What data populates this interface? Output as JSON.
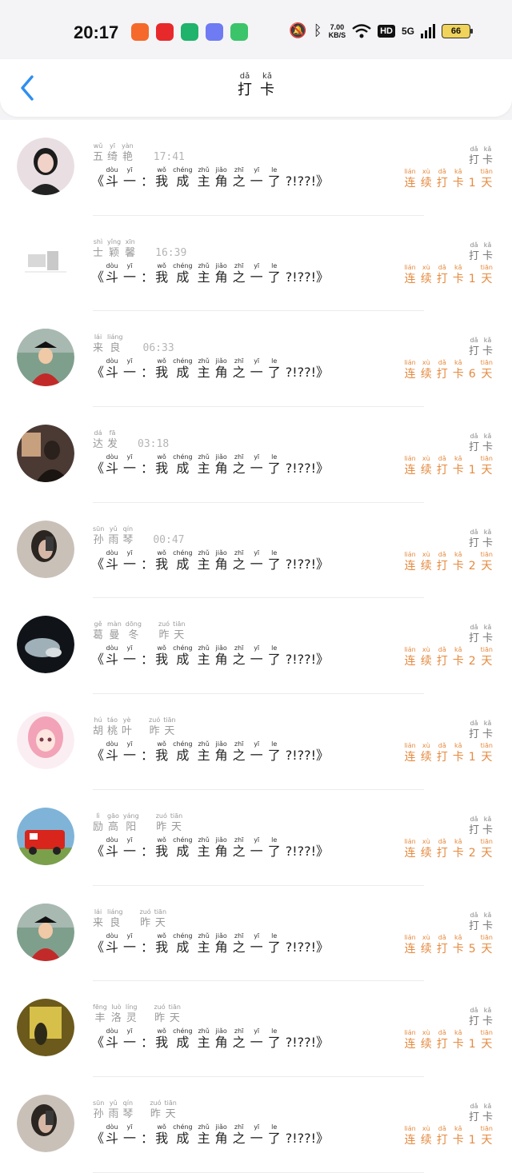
{
  "status_bar": {
    "time": "20:17",
    "speed_value": "7.00",
    "speed_unit": "KB/S",
    "hd": "HD",
    "network": "5G",
    "battery": "66",
    "app_icons": [
      "#f56a2a",
      "#e8292b",
      "#1fb36b",
      "#6e7bf2",
      "#3bc46a"
    ]
  },
  "header": {
    "title": [
      {
        "py": "dǎ",
        "hz": "打"
      },
      {
        "py": "kǎ",
        "hz": "卡"
      }
    ],
    "accent": "#2f8ef0"
  },
  "common": {
    "post_title": [
      {
        "t": "p",
        "v": "《"
      },
      {
        "py": "dòu",
        "hz": "斗"
      },
      {
        "py": "yī",
        "hz": "一"
      },
      {
        "t": "p",
        "v": "："
      },
      {
        "py": "wǒ",
        "hz": "我"
      },
      {
        "py": "chéng",
        "hz": "成"
      },
      {
        "py": "zhǔ",
        "hz": "主"
      },
      {
        "py": "jiǎo",
        "hz": "角"
      },
      {
        "py": "zhī",
        "hz": "之"
      },
      {
        "py": "yī",
        "hz": "一"
      },
      {
        "py": "le",
        "hz": "了"
      },
      {
        "t": "p",
        "v": "?!??!》"
      }
    ],
    "checkin_label": [
      {
        "py": "dǎ",
        "hz": "打"
      },
      {
        "py": "kǎ",
        "hz": "卡"
      }
    ],
    "streak_prefix": [
      {
        "py": "lián",
        "hz": "连"
      },
      {
        "py": "xù",
        "hz": "续"
      },
      {
        "py": "dǎ",
        "hz": "打"
      },
      {
        "py": "kǎ",
        "hz": "卡"
      }
    ],
    "streak_suffix": {
      "py": "tiān",
      "hz": "天"
    },
    "streak_color": "#e58a3f"
  },
  "entries": [
    {
      "name": [
        {
          "py": "wǔ",
          "hz": "五"
        },
        {
          "py": "yī",
          "hz": "绮"
        },
        {
          "py": "yàn",
          "hz": "艳"
        }
      ],
      "time": "17:41",
      "days": "1",
      "avatar": "girl-portrait"
    },
    {
      "name": [
        {
          "py": "shì",
          "hz": "士"
        },
        {
          "py": "yǐng",
          "hz": "颖"
        },
        {
          "py": "xīn",
          "hz": "馨"
        }
      ],
      "time": "16:39",
      "days": "1",
      "avatar": "sketch-landscape"
    },
    {
      "name": [
        {
          "py": "lái",
          "hz": "来"
        },
        {
          "py": "liáng",
          "hz": "良"
        }
      ],
      "time": "06:33",
      "days": "6",
      "avatar": "graduation-child"
    },
    {
      "name": [
        {
          "py": "dá",
          "hz": "达"
        },
        {
          "py": "fā",
          "hz": "发"
        }
      ],
      "time": "03:18",
      "days": "1",
      "avatar": "man-dark-room"
    },
    {
      "name": [
        {
          "py": "sūn",
          "hz": "孙"
        },
        {
          "py": "yǔ",
          "hz": "雨"
        },
        {
          "py": "qín",
          "hz": "琴"
        }
      ],
      "time": "00:47",
      "days": "2",
      "avatar": "woman-phone-selfie"
    },
    {
      "name": [
        {
          "py": "gě",
          "hz": "葛"
        },
        {
          "py": "màn",
          "hz": "曼"
        },
        {
          "py": "dōng",
          "hz": "冬"
        }
      ],
      "time_zh": [
        {
          "py": "zuó",
          "hz": "昨"
        },
        {
          "py": "tiān",
          "hz": "天"
        }
      ],
      "days": "2",
      "avatar": "dark-scene"
    },
    {
      "name": [
        {
          "py": "hú",
          "hz": "胡"
        },
        {
          "py": "táo",
          "hz": "桃"
        },
        {
          "py": "yè",
          "hz": "叶"
        }
      ],
      "time_zh": [
        {
          "py": "zuó",
          "hz": "昨"
        },
        {
          "py": "tiān",
          "hz": "天"
        }
      ],
      "days": "1",
      "avatar": "pink-hair-anime"
    },
    {
      "name": [
        {
          "py": "lì",
          "hz": "励"
        },
        {
          "py": "gāo",
          "hz": "高"
        },
        {
          "py": "yáng",
          "hz": "阳"
        }
      ],
      "time_zh": [
        {
          "py": "zuó",
          "hz": "昨"
        },
        {
          "py": "tiān",
          "hz": "天"
        }
      ],
      "days": "2",
      "avatar": "red-fire-truck"
    },
    {
      "name": [
        {
          "py": "lái",
          "hz": "来"
        },
        {
          "py": "liáng",
          "hz": "良"
        }
      ],
      "time_zh": [
        {
          "py": "zuó",
          "hz": "昨"
        },
        {
          "py": "tiān",
          "hz": "天"
        }
      ],
      "days": "5",
      "avatar": "graduation-child"
    },
    {
      "name": [
        {
          "py": "fēng",
          "hz": "丰"
        },
        {
          "py": "luò",
          "hz": "洛"
        },
        {
          "py": "líng",
          "hz": "灵"
        }
      ],
      "time_zh": [
        {
          "py": "zuó",
          "hz": "昨"
        },
        {
          "py": "tiān",
          "hz": "天"
        }
      ],
      "days": "1",
      "avatar": "yellow-scene"
    },
    {
      "name": [
        {
          "py": "sūn",
          "hz": "孙"
        },
        {
          "py": "yǔ",
          "hz": "雨"
        },
        {
          "py": "qín",
          "hz": "琴"
        }
      ],
      "time_zh": [
        {
          "py": "zuó",
          "hz": "昨"
        },
        {
          "py": "tiān",
          "hz": "天"
        }
      ],
      "days": "1",
      "avatar": "woman-phone-selfie"
    }
  ]
}
